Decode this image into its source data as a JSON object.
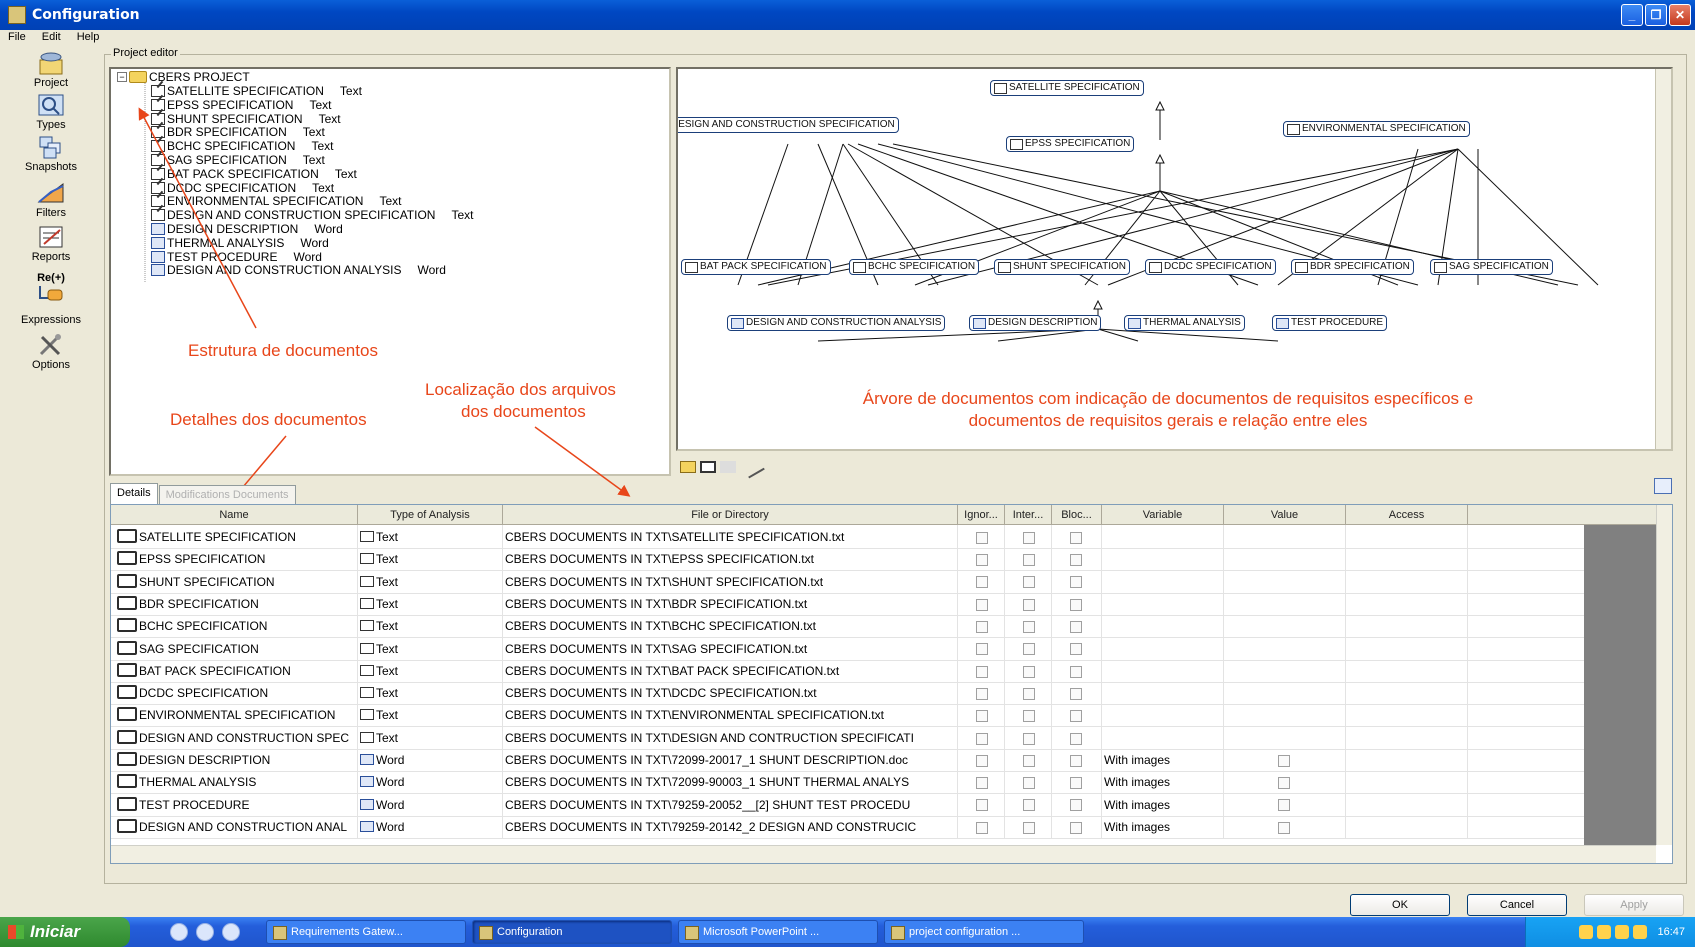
{
  "window": {
    "title": "Configuration"
  },
  "menu": [
    "File",
    "Edit",
    "Help"
  ],
  "sidebar": [
    {
      "label": "Project",
      "icon": "project-icon"
    },
    {
      "label": "Types",
      "icon": "types-icon"
    },
    {
      "label": "Snapshots",
      "icon": "snapshots-icon"
    },
    {
      "label": "Filters",
      "icon": "filters-icon"
    },
    {
      "label": "Reports",
      "icon": "reports-icon"
    },
    {
      "label": "Re(+)",
      "icon": "regex-icon"
    },
    {
      "label": "Expressions",
      "icon": "expressions-icon"
    },
    {
      "label": "Options",
      "icon": "options-icon"
    }
  ],
  "editor": {
    "group_label": "Project editor"
  },
  "tree": {
    "root": "CBERS PROJECT",
    "items": [
      {
        "name": "SATELLITE SPECIFICATION",
        "type": "Text"
      },
      {
        "name": "EPSS SPECIFICATION",
        "type": "Text"
      },
      {
        "name": "SHUNT SPECIFICATION",
        "type": "Text"
      },
      {
        "name": "BDR SPECIFICATION",
        "type": "Text"
      },
      {
        "name": "BCHC SPECIFICATION",
        "type": "Text"
      },
      {
        "name": "SAG SPECIFICATION",
        "type": "Text"
      },
      {
        "name": "BAT PACK SPECIFICATION",
        "type": "Text"
      },
      {
        "name": "DCDC SPECIFICATION",
        "type": "Text"
      },
      {
        "name": "ENVIRONMENTAL SPECIFICATION",
        "type": "Text"
      },
      {
        "name": "DESIGN AND CONSTRUCTION SPECIFICATION",
        "type": "Text"
      },
      {
        "name": "DESIGN DESCRIPTION",
        "type": "Word"
      },
      {
        "name": "THERMAL ANALYSIS",
        "type": "Word"
      },
      {
        "name": "TEST PROCEDURE",
        "type": "Word"
      },
      {
        "name": "DESIGN AND CONSTRUCTION ANALYSIS",
        "type": "Word"
      }
    ]
  },
  "annotations": {
    "structure": "Estrutura de documentos",
    "details": "Detalhes dos documentos",
    "location_1": "Localização dos arquivos",
    "location_2": "dos documentos",
    "tree_1": "Árvore de documentos com indicação de documentos de requisitos específicos e",
    "tree_2": "documentos de requisitos gerais e relação entre eles"
  },
  "graph": {
    "nodes": {
      "satellite": "SATELLITE SPECIFICATION",
      "design_construction": "DESIGN AND CONSTRUCTION SPECIFICATION",
      "epss": "EPSS SPECIFICATION",
      "environmental": "ENVIRONMENTAL SPECIFICATION",
      "bat_pack": "BAT PACK SPECIFICATION",
      "bchc": "BCHC SPECIFICATION",
      "shunt": "SHUNT SPECIFICATION",
      "dcdc": "DCDC SPECIFICATION",
      "bdr": "BDR SPECIFICATION",
      "sag": "SAG SPECIFICATION",
      "dc_analysis": "DESIGN AND CONSTRUCTION ANALYSIS",
      "design_description": "DESIGN DESCRIPTION",
      "thermal": "THERMAL ANALYSIS",
      "test_procedure": "TEST PROCEDURE"
    }
  },
  "tabs": [
    {
      "label": "Details",
      "active": true
    },
    {
      "label": "Modifications Documents",
      "active": false
    }
  ],
  "table": {
    "headers": [
      "Name",
      "Type of Analysis",
      "File or Directory",
      "Ignor...",
      "Inter...",
      "Bloc...",
      "Variable",
      "Value",
      "Access"
    ],
    "rows": [
      {
        "name": "SATELLITE SPECIFICATION",
        "type": "Text",
        "file": "CBERS DOCUMENTS IN TXT\\SATELLITE SPECIFICATION.txt",
        "variable": ""
      },
      {
        "name": "EPSS SPECIFICATION",
        "type": "Text",
        "file": "CBERS DOCUMENTS IN TXT\\EPSS SPECIFICATION.txt",
        "variable": ""
      },
      {
        "name": "SHUNT SPECIFICATION",
        "type": "Text",
        "file": "CBERS DOCUMENTS IN TXT\\SHUNT SPECIFICATION.txt",
        "variable": ""
      },
      {
        "name": "BDR SPECIFICATION",
        "type": "Text",
        "file": "CBERS DOCUMENTS IN TXT\\BDR SPECIFICATION.txt",
        "variable": ""
      },
      {
        "name": "BCHC SPECIFICATION",
        "type": "Text",
        "file": "CBERS DOCUMENTS IN TXT\\BCHC SPECIFICATION.txt",
        "variable": ""
      },
      {
        "name": "SAG SPECIFICATION",
        "type": "Text",
        "file": "CBERS DOCUMENTS IN TXT\\SAG SPECIFICATION.txt",
        "variable": ""
      },
      {
        "name": "BAT PACK SPECIFICATION",
        "type": "Text",
        "file": "CBERS DOCUMENTS IN TXT\\BAT PACK SPECIFICATION.txt",
        "variable": ""
      },
      {
        "name": "DCDC SPECIFICATION",
        "type": "Text",
        "file": "CBERS DOCUMENTS IN TXT\\DCDC SPECIFICATION.txt",
        "variable": ""
      },
      {
        "name": "ENVIRONMENTAL SPECIFICATION",
        "type": "Text",
        "file": "CBERS DOCUMENTS IN TXT\\ENVIRONMENTAL SPECIFICATION.txt",
        "variable": ""
      },
      {
        "name": "DESIGN AND CONSTRUCTION SPEC",
        "type": "Text",
        "file": "CBERS DOCUMENTS IN TXT\\DESIGN AND CONTRUCTION SPECIFICATI",
        "variable": ""
      },
      {
        "name": "DESIGN DESCRIPTION",
        "type": "Word",
        "file": "CBERS DOCUMENTS IN TXT\\72099-20017_1 SHUNT DESCRIPTION.doc",
        "variable": "With images"
      },
      {
        "name": "THERMAL ANALYSIS",
        "type": "Word",
        "file": "CBERS DOCUMENTS IN TXT\\72099-90003_1 SHUNT THERMAL ANALYS",
        "variable": "With images"
      },
      {
        "name": "TEST PROCEDURE",
        "type": "Word",
        "file": "CBERS DOCUMENTS IN TXT\\79259-20052__[2] SHUNT TEST PROCEDU",
        "variable": "With images"
      },
      {
        "name": "DESIGN AND CONSTRUCTION ANAL",
        "type": "Word",
        "file": "CBERS DOCUMENTS IN TXT\\79259-20142_2 DESIGN AND CONSTRUCIC",
        "variable": "With images"
      }
    ]
  },
  "buttons": {
    "ok": "OK",
    "cancel": "Cancel",
    "apply": "Apply"
  },
  "taskbar": {
    "start": "Iniciar",
    "tasks": [
      "Requirements Gatew...",
      "Configuration",
      "Microsoft PowerPoint ...",
      "project configuration ..."
    ],
    "clock": "16:47"
  }
}
